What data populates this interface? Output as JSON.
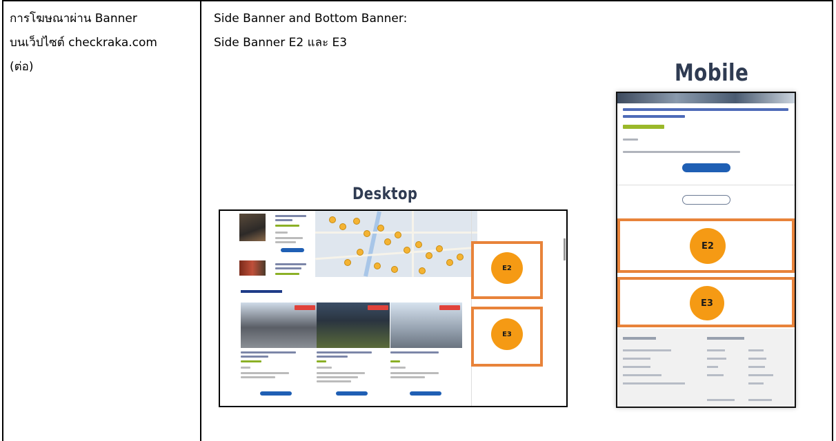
{
  "left_cell": {
    "line1": "การโฆษณาผ่าน Banner",
    "line2": "บนเว็ปไซต์ checkraka.com",
    "line3": "(ต่อ)"
  },
  "right_cell": {
    "line1": "Side Banner and Bottom Banner:",
    "line2": "Side Banner E2 และ E3"
  },
  "mockups": {
    "mobile_heading": "Mobile",
    "desktop_heading": "Desktop",
    "banner_e2": "E2",
    "banner_e3": "E3",
    "accent_color": "#e8833a",
    "circle_color": "#f59a14"
  }
}
